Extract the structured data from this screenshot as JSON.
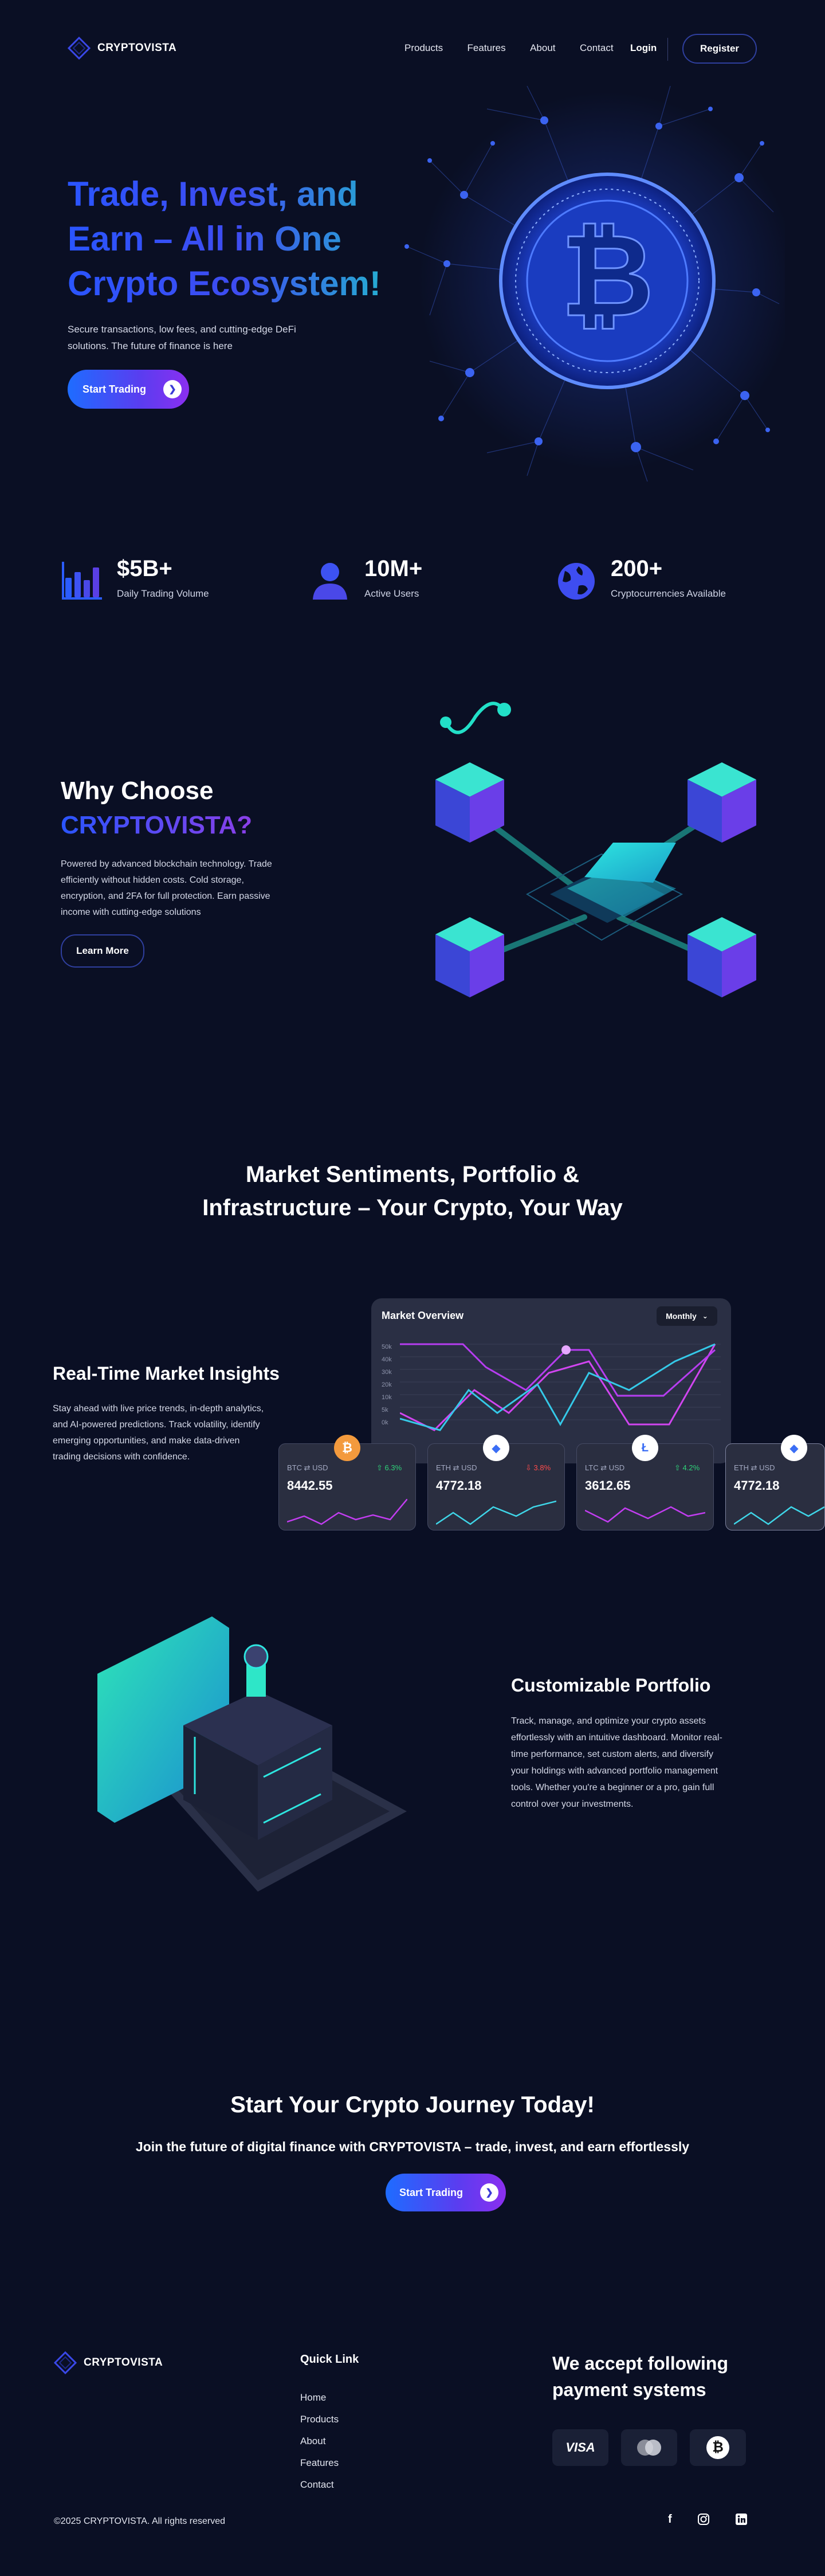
{
  "brand": {
    "name": "CRYPTOVISTA"
  },
  "nav": {
    "items": [
      "Products",
      "Features",
      "About",
      "Contact"
    ],
    "login": "Login",
    "register": "Register"
  },
  "hero": {
    "title_line1": "Trade, Invest, and",
    "title_line2": "Earn – All in One",
    "title_line3": "Crypto Ecosystem!",
    "subtitle_line1": "Secure transactions, low fees, and cutting-edge DeFi",
    "subtitle_line2": "solutions. The future of finance is here",
    "cta": "Start Trading"
  },
  "stats": [
    {
      "value": "$5B+",
      "label": "Daily Trading Volume",
      "icon": "bar-chart-icon"
    },
    {
      "value": "10M+",
      "label": "Active Users",
      "icon": "user-icon"
    },
    {
      "value": "200+",
      "label": "Cryptocurrencies Available",
      "icon": "globe-icon"
    }
  ],
  "why": {
    "title_line1": "Why Choose",
    "title_line2": "CRYPTOVISTA?",
    "text_line1": "Powered by advanced blockchain technology. Trade",
    "text_line2": "efficiently without hidden costs. Cold storage,",
    "text_line3": "encryption, and 2FA for full protection. Earn passive",
    "text_line4": "income with cutting-edge solutions",
    "cta": "Learn More"
  },
  "sentiments": {
    "title_line1": "Market Sentiments, Portfolio &",
    "title_line2": "Infrastructure – Your Crypto, Your Way"
  },
  "insights": {
    "title": "Real-Time Market Insights",
    "text_line1": "Stay ahead with live price trends, in-depth analytics,",
    "text_line2": "and AI-powered predictions. Track volatility, identify",
    "text_line3": "emerging opportunities, and make data-driven",
    "text_line4": "trading decisions with confidence."
  },
  "market_overview": {
    "title": "Market Overview",
    "period": "Monthly",
    "y_ticks": [
      "50k",
      "40k",
      "30k",
      "20k",
      "10k",
      "5k",
      "0k"
    ]
  },
  "tickers": [
    {
      "base": "BTC",
      "quote": "USD",
      "change": "6.3%",
      "price": "8442.55",
      "direction": "up",
      "coin_color": "#f39a3d",
      "coin_symbol": "₿"
    },
    {
      "base": "ETH",
      "quote": "USD",
      "change": "3.8%",
      "price": "4772.18",
      "direction": "down",
      "coin_color": "#6a8cff",
      "coin_symbol": "◆"
    },
    {
      "base": "LTC",
      "quote": "USD",
      "change": "4.2%",
      "price": "3612.65",
      "direction": "up",
      "coin_color": "#3b6ef5",
      "coin_symbol": "Ł"
    },
    {
      "base": "ETH",
      "quote": "USD",
      "change": "",
      "price": "4772.18",
      "direction": "up",
      "coin_color": "#6a8cff",
      "coin_symbol": "◆"
    }
  ],
  "portfolio": {
    "title": "Customizable Portfolio",
    "text_line1": "Track, manage, and optimize your crypto assets",
    "text_line2": "effortlessly with an intuitive dashboard. Monitor real-",
    "text_line3": "time performance, set custom alerts, and diversify",
    "text_line4": "your holdings with advanced portfolio management",
    "text_line5": "tools. Whether you're a beginner or a pro, gain full",
    "text_line6": "control over your investments."
  },
  "journey": {
    "title": "Start Your Crypto Journey Today!",
    "subtitle": "Join the future of digital finance with CRYPTOVISTA – trade, invest, and earn effortlessly",
    "cta": "Start Trading"
  },
  "footer": {
    "quick_link_title": "Quick Link",
    "links": [
      "Home",
      "Products",
      "About",
      "Features",
      "Contact"
    ],
    "payments_title_line1": "We accept following",
    "payments_title_line2": "payment systems",
    "payments": [
      "VISA",
      "mastercard",
      "bitcoin"
    ],
    "copyright": "©2025 CRYPTOVISTA. All rights reserved",
    "social": [
      "facebook-icon",
      "instagram-icon",
      "linkedin-icon"
    ]
  },
  "colors": {
    "background": "#0a0f24",
    "accent_blue": "#1e6cff",
    "accent_purple": "#8b2ff0",
    "accent_teal": "#1bd6c4",
    "up": "#2fd37a",
    "down": "#ff4b4b"
  }
}
